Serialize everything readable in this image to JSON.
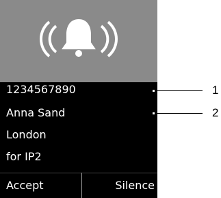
{
  "incoming_call": {
    "icon": "ringing-bell-icon",
    "number": "1234567890",
    "name": "Anna Sand",
    "location": "London",
    "line": "for  IP2"
  },
  "soft_keys": {
    "left": "Accept",
    "right": "Silence"
  },
  "callouts": [
    "1",
    "2"
  ],
  "colors": {
    "display_bg": "#000000",
    "icon_bg": "#8a8a8a",
    "text": "#ffffff"
  }
}
